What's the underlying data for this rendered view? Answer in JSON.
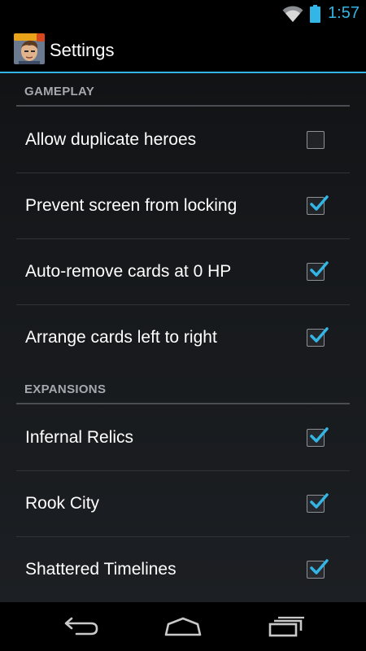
{
  "status_bar": {
    "time": "1:57",
    "icons": [
      "wifi-icon",
      "battery-icon"
    ],
    "accent_color": "#33b5e5"
  },
  "action_bar": {
    "title": "Settings",
    "icon": "app-icon"
  },
  "sections": {
    "gameplay": {
      "header": "GAMEPLAY",
      "items": [
        {
          "label": "Allow duplicate heroes",
          "checked": false
        },
        {
          "label": "Prevent screen from locking",
          "checked": true
        },
        {
          "label": "Auto-remove cards at 0 HP",
          "checked": true
        },
        {
          "label": "Arrange cards left to right",
          "checked": true
        }
      ]
    },
    "expansions": {
      "header": "EXPANSIONS",
      "items": [
        {
          "label": "Infernal Relics",
          "checked": true
        },
        {
          "label": "Rook City",
          "checked": true
        },
        {
          "label": "Shattered Timelines",
          "checked": true
        }
      ]
    }
  },
  "nav_bar": {
    "buttons": [
      "back-icon",
      "home-icon",
      "recent-apps-icon"
    ]
  }
}
